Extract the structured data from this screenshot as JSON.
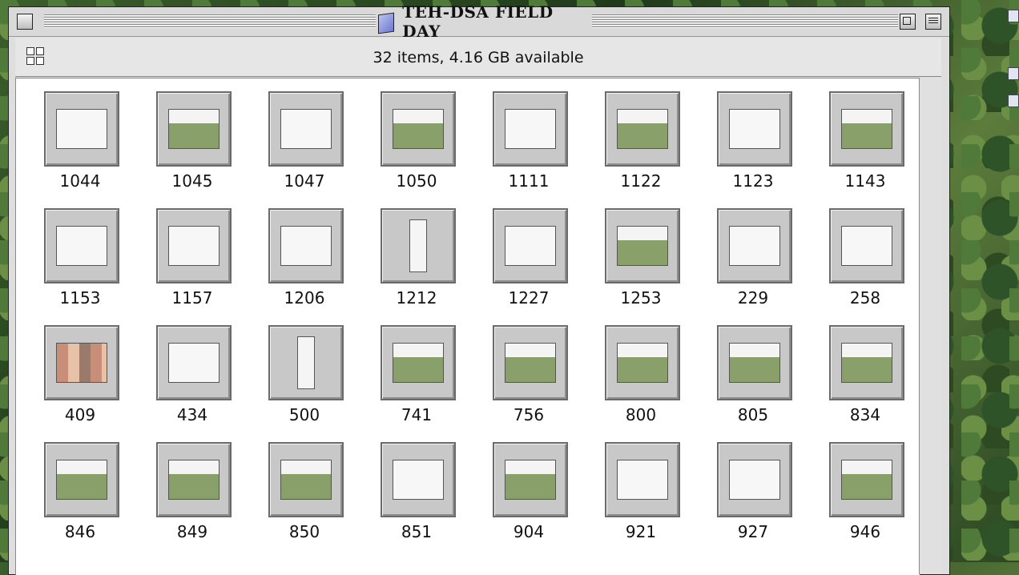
{
  "window": {
    "title": "TEH-DSA FIELD DAY",
    "info": "32 items, 4.16 GB available"
  },
  "icons": [
    {
      "label": "1044",
      "style": "white"
    },
    {
      "label": "1045",
      "style": "desk"
    },
    {
      "label": "1047",
      "style": "white"
    },
    {
      "label": "1050",
      "style": "desk"
    },
    {
      "label": "1111",
      "style": "white"
    },
    {
      "label": "1122",
      "style": "desk"
    },
    {
      "label": "1123",
      "style": "white"
    },
    {
      "label": "1143",
      "style": "desk"
    },
    {
      "label": "1153",
      "style": "white"
    },
    {
      "label": "1157",
      "style": "white"
    },
    {
      "label": "1206",
      "style": "white"
    },
    {
      "label": "1212",
      "style": "tall"
    },
    {
      "label": "1227",
      "style": "white"
    },
    {
      "label": "1253",
      "style": "desk"
    },
    {
      "label": "229",
      "style": "white"
    },
    {
      "label": "258",
      "style": "white"
    },
    {
      "label": "409",
      "style": "photo"
    },
    {
      "label": "434",
      "style": "white"
    },
    {
      "label": "500",
      "style": "tall"
    },
    {
      "label": "741",
      "style": "desk"
    },
    {
      "label": "756",
      "style": "desk"
    },
    {
      "label": "800",
      "style": "desk"
    },
    {
      "label": "805",
      "style": "desk"
    },
    {
      "label": "834",
      "style": "desk"
    },
    {
      "label": "846",
      "style": "desk"
    },
    {
      "label": "849",
      "style": "desk"
    },
    {
      "label": "850",
      "style": "desk"
    },
    {
      "label": "851",
      "style": "white"
    },
    {
      "label": "904",
      "style": "desk"
    },
    {
      "label": "921",
      "style": "white"
    },
    {
      "label": "927",
      "style": "white"
    },
    {
      "label": "946",
      "style": "desk"
    }
  ]
}
